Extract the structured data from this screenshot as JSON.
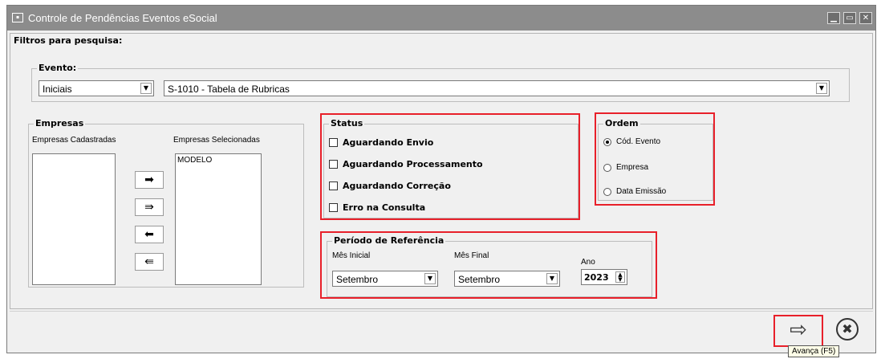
{
  "window": {
    "title": "Controle de Pendências Eventos eSocial",
    "app_icon": "app-window-icon",
    "controls": [
      "minimize-icon",
      "maximize-icon",
      "close-icon"
    ]
  },
  "filters": {
    "title": "Filtros para pesquisa:",
    "evento": {
      "label": "Evento:",
      "type_value": "Iniciais",
      "event_value": "S-1010 - Tabela de Rubricas"
    }
  },
  "empresas": {
    "label": "Empresas",
    "cadastradas_label": "Empresas Cadastradas",
    "selecionadas_label": "Empresas Selecionadas",
    "cadastradas_items": [],
    "selecionadas_items": [
      "MODELO"
    ],
    "buttons": [
      "move-right-icon",
      "move-all-right-icon",
      "move-left-icon",
      "move-all-left-icon"
    ]
  },
  "status": {
    "label": "Status",
    "options": [
      {
        "label": "Aguardando Envio",
        "checked": false
      },
      {
        "label": "Aguardando Processamento",
        "checked": false
      },
      {
        "label": "Aguardando Correção",
        "checked": false
      },
      {
        "label": "Erro na Consulta",
        "checked": false
      }
    ]
  },
  "ordem": {
    "label": "Ordem",
    "options": [
      {
        "label": "Cód. Evento",
        "selected": true
      },
      {
        "label": "Empresa",
        "selected": false
      },
      {
        "label": "Data Emissão",
        "selected": false
      }
    ]
  },
  "periodo": {
    "label": "Período de Referência",
    "mes_inicial_label": "Mês Inicial",
    "mes_inicial_value": "Setembro",
    "mes_final_label": "Mês Final",
    "mes_final_value": "Setembro",
    "ano_label": "Ano",
    "ano_value": "2023"
  },
  "footer": {
    "advance_icon": "arrow-right-icon",
    "cancel_icon": "cancel-circle-icon",
    "tooltip": "Avança (F5)"
  },
  "colors": {
    "highlight": "#e8202a",
    "titlebar": "#8c8c8c"
  }
}
